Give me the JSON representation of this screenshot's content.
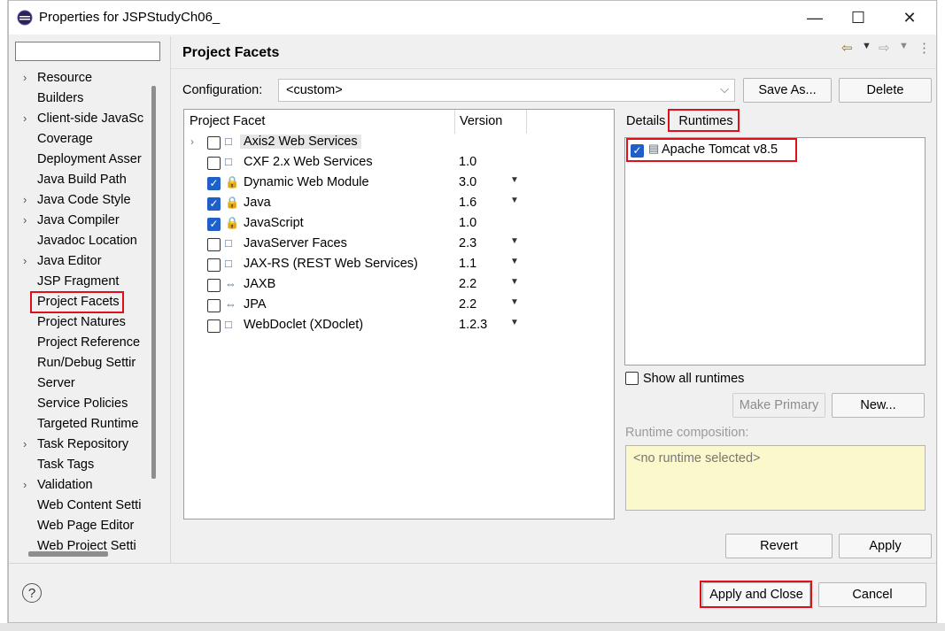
{
  "window": {
    "title": "Properties for JSPStudyCh06_",
    "minimize_glyph": "—",
    "maximize_glyph": "☐",
    "close_glyph": "✕"
  },
  "filter": {
    "value": ""
  },
  "nav": {
    "items": [
      {
        "label": "Resource",
        "expandable": true
      },
      {
        "label": "Builders",
        "expandable": false
      },
      {
        "label": "Client-side JavaSc",
        "expandable": true
      },
      {
        "label": "Coverage",
        "expandable": false
      },
      {
        "label": "Deployment Asser",
        "expandable": false
      },
      {
        "label": "Java Build Path",
        "expandable": false
      },
      {
        "label": "Java Code Style",
        "expandable": true
      },
      {
        "label": "Java Compiler",
        "expandable": true
      },
      {
        "label": "Javadoc Location",
        "expandable": false
      },
      {
        "label": "Java Editor",
        "expandable": true
      },
      {
        "label": "JSP Fragment",
        "expandable": false
      },
      {
        "label": "Project Facets",
        "expandable": false,
        "selected": true
      },
      {
        "label": "Project Natures",
        "expandable": false
      },
      {
        "label": "Project Reference",
        "expandable": false
      },
      {
        "label": "Run/Debug Settir",
        "expandable": false
      },
      {
        "label": "Server",
        "expandable": false
      },
      {
        "label": "Service Policies",
        "expandable": false
      },
      {
        "label": "Targeted Runtime",
        "expandable": false
      },
      {
        "label": "Task Repository",
        "expandable": true
      },
      {
        "label": "Task Tags",
        "expandable": false
      },
      {
        "label": "Validation",
        "expandable": true
      },
      {
        "label": "Web Content Setti",
        "expandable": false
      },
      {
        "label": "Web Page Editor",
        "expandable": false
      },
      {
        "label": "Web Project Setti",
        "expandable": false
      }
    ]
  },
  "page": {
    "title": "Project Facets"
  },
  "config": {
    "label": "Configuration:",
    "value": "<custom>",
    "save_as": "Save As...",
    "delete": "Delete"
  },
  "facets": {
    "headers": {
      "facet": "Project Facet",
      "version": "Version"
    },
    "rows": [
      {
        "name": "Axis2 Web Services",
        "version": "",
        "checked": false,
        "has_dropdown": false,
        "expandable": true,
        "selected": true,
        "icon": "□"
      },
      {
        "name": "CXF 2.x Web Services",
        "version": "1.0",
        "checked": false,
        "has_dropdown": false,
        "icon": "□"
      },
      {
        "name": "Dynamic Web Module",
        "version": "3.0",
        "checked": true,
        "has_dropdown": true,
        "icon": "🔒"
      },
      {
        "name": "Java",
        "version": "1.6",
        "checked": true,
        "has_dropdown": true,
        "icon": "🔒"
      },
      {
        "name": "JavaScript",
        "version": "1.0",
        "checked": true,
        "has_dropdown": false,
        "icon": "🔒"
      },
      {
        "name": "JavaServer Faces",
        "version": "2.3",
        "checked": false,
        "has_dropdown": true,
        "icon": "□"
      },
      {
        "name": "JAX-RS (REST Web Services)",
        "version": "1.1",
        "checked": false,
        "has_dropdown": true,
        "icon": "□"
      },
      {
        "name": "JAXB",
        "version": "2.2",
        "checked": false,
        "has_dropdown": true,
        "icon": "⇔"
      },
      {
        "name": "JPA",
        "version": "2.2",
        "checked": false,
        "has_dropdown": true,
        "icon": "⇔"
      },
      {
        "name": "WebDoclet (XDoclet)",
        "version": "1.2.3",
        "checked": false,
        "has_dropdown": true,
        "icon": "□"
      }
    ]
  },
  "side_tabs": {
    "details": "Details",
    "runtimes": "Runtimes"
  },
  "runtimes": {
    "items": [
      {
        "name": "Apache Tomcat v8.5",
        "checked": true
      }
    ],
    "show_all_label": "Show all runtimes",
    "make_primary": "Make Primary",
    "new": "New...",
    "composition_label": "Runtime composition:",
    "composition_value": "<no runtime selected>"
  },
  "footer": {
    "revert": "Revert",
    "apply": "Apply",
    "apply_close": "Apply and Close",
    "cancel": "Cancel"
  },
  "colors": {
    "accent_blue": "#1f5fc9",
    "highlight_red": "#e0101a",
    "composition_bg": "#fbf8cc"
  }
}
